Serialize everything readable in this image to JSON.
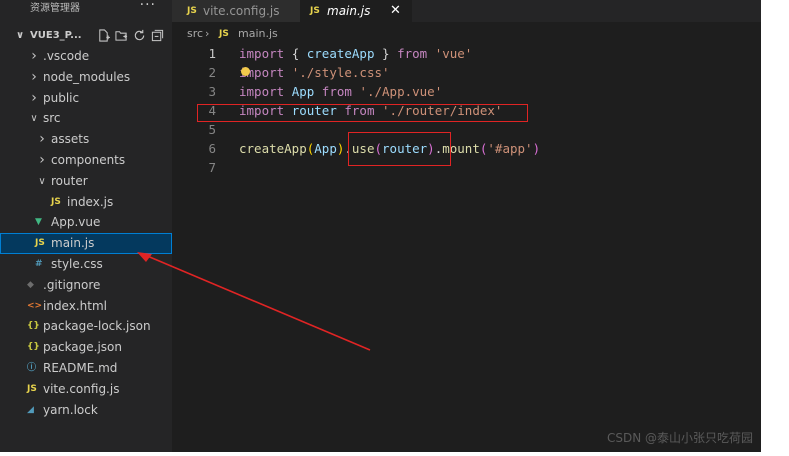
{
  "sidebar": {
    "header_title": "资源管理器",
    "more_label": "···",
    "project_name": "VUE3_P...",
    "items": [
      {
        "label": ".vscode",
        "type": "folder",
        "expanded": false,
        "depth": 0
      },
      {
        "label": "node_modules",
        "type": "folder",
        "expanded": false,
        "depth": 0
      },
      {
        "label": "public",
        "type": "folder",
        "expanded": false,
        "depth": 0
      },
      {
        "label": "src",
        "type": "folder",
        "expanded": true,
        "depth": 0
      },
      {
        "label": "assets",
        "type": "folder",
        "expanded": false,
        "depth": 1
      },
      {
        "label": "components",
        "type": "folder",
        "expanded": false,
        "depth": 1
      },
      {
        "label": "router",
        "type": "folder",
        "expanded": true,
        "depth": 1
      },
      {
        "label": "index.js",
        "type": "js",
        "depth": 2
      },
      {
        "label": "App.vue",
        "type": "vue",
        "depth": 1
      },
      {
        "label": "main.js",
        "type": "js",
        "depth": 1,
        "selected": true
      },
      {
        "label": "style.css",
        "type": "css",
        "depth": 1
      },
      {
        "label": ".gitignore",
        "type": "git",
        "depth": 0
      },
      {
        "label": "index.html",
        "type": "html",
        "depth": 0
      },
      {
        "label": "package-lock.json",
        "type": "json",
        "depth": 0
      },
      {
        "label": "package.json",
        "type": "json",
        "depth": 0
      },
      {
        "label": "README.md",
        "type": "info",
        "depth": 0
      },
      {
        "label": "vite.config.js",
        "type": "js",
        "depth": 0
      },
      {
        "label": "yarn.lock",
        "type": "yarn",
        "depth": 0
      }
    ]
  },
  "tabs": [
    {
      "icon": "JS",
      "label": "vite.config.js",
      "active": false
    },
    {
      "icon": "JS",
      "label": "main.js",
      "active": true,
      "close": "✕"
    }
  ],
  "breadcrumb": {
    "folder": "src",
    "separator": "›",
    "icon": "JS",
    "file": "main.js"
  },
  "editor": {
    "lines": [
      {
        "n": "1",
        "tokens": [
          [
            "kw",
            "import "
          ],
          [
            "punc",
            "{ "
          ],
          [
            "var",
            "createApp"
          ],
          [
            "punc",
            " } "
          ],
          [
            "kw",
            "from "
          ],
          [
            "str",
            "'vue'"
          ]
        ]
      },
      {
        "n": "2",
        "tokens": [
          [
            "kw",
            "import "
          ],
          [
            "str",
            "'./style.css'"
          ]
        ]
      },
      {
        "n": "3",
        "tokens": [
          [
            "kw",
            "import "
          ],
          [
            "var",
            "App "
          ],
          [
            "kw",
            "from "
          ],
          [
            "str",
            "'./App.vue'"
          ]
        ]
      },
      {
        "n": "4",
        "tokens": [
          [
            "kw",
            "import "
          ],
          [
            "var",
            "router "
          ],
          [
            "kw",
            "from "
          ],
          [
            "str",
            "'./router/index'"
          ]
        ]
      },
      {
        "n": "5",
        "tokens": []
      },
      {
        "n": "6",
        "tokens": [
          [
            "fn",
            "createApp"
          ],
          [
            "br",
            "("
          ],
          [
            "var",
            "App"
          ],
          [
            "br",
            ")"
          ],
          [
            "punc",
            "."
          ],
          [
            "fn",
            "use"
          ],
          [
            "br2",
            "("
          ],
          [
            "var",
            "router"
          ],
          [
            "br2",
            ")"
          ],
          [
            "punc",
            "."
          ],
          [
            "fn",
            "mount"
          ],
          [
            "br2",
            "("
          ],
          [
            "str",
            "'#app'"
          ],
          [
            "br2",
            ")"
          ]
        ]
      },
      {
        "n": "7",
        "tokens": []
      }
    ]
  },
  "watermark": "CSDN @泰山小张只吃荷园",
  "colors": {
    "annotation": "#e02424",
    "selection": "#04395e",
    "js_icon": "#e8d44d",
    "vue_icon": "#41b883"
  }
}
